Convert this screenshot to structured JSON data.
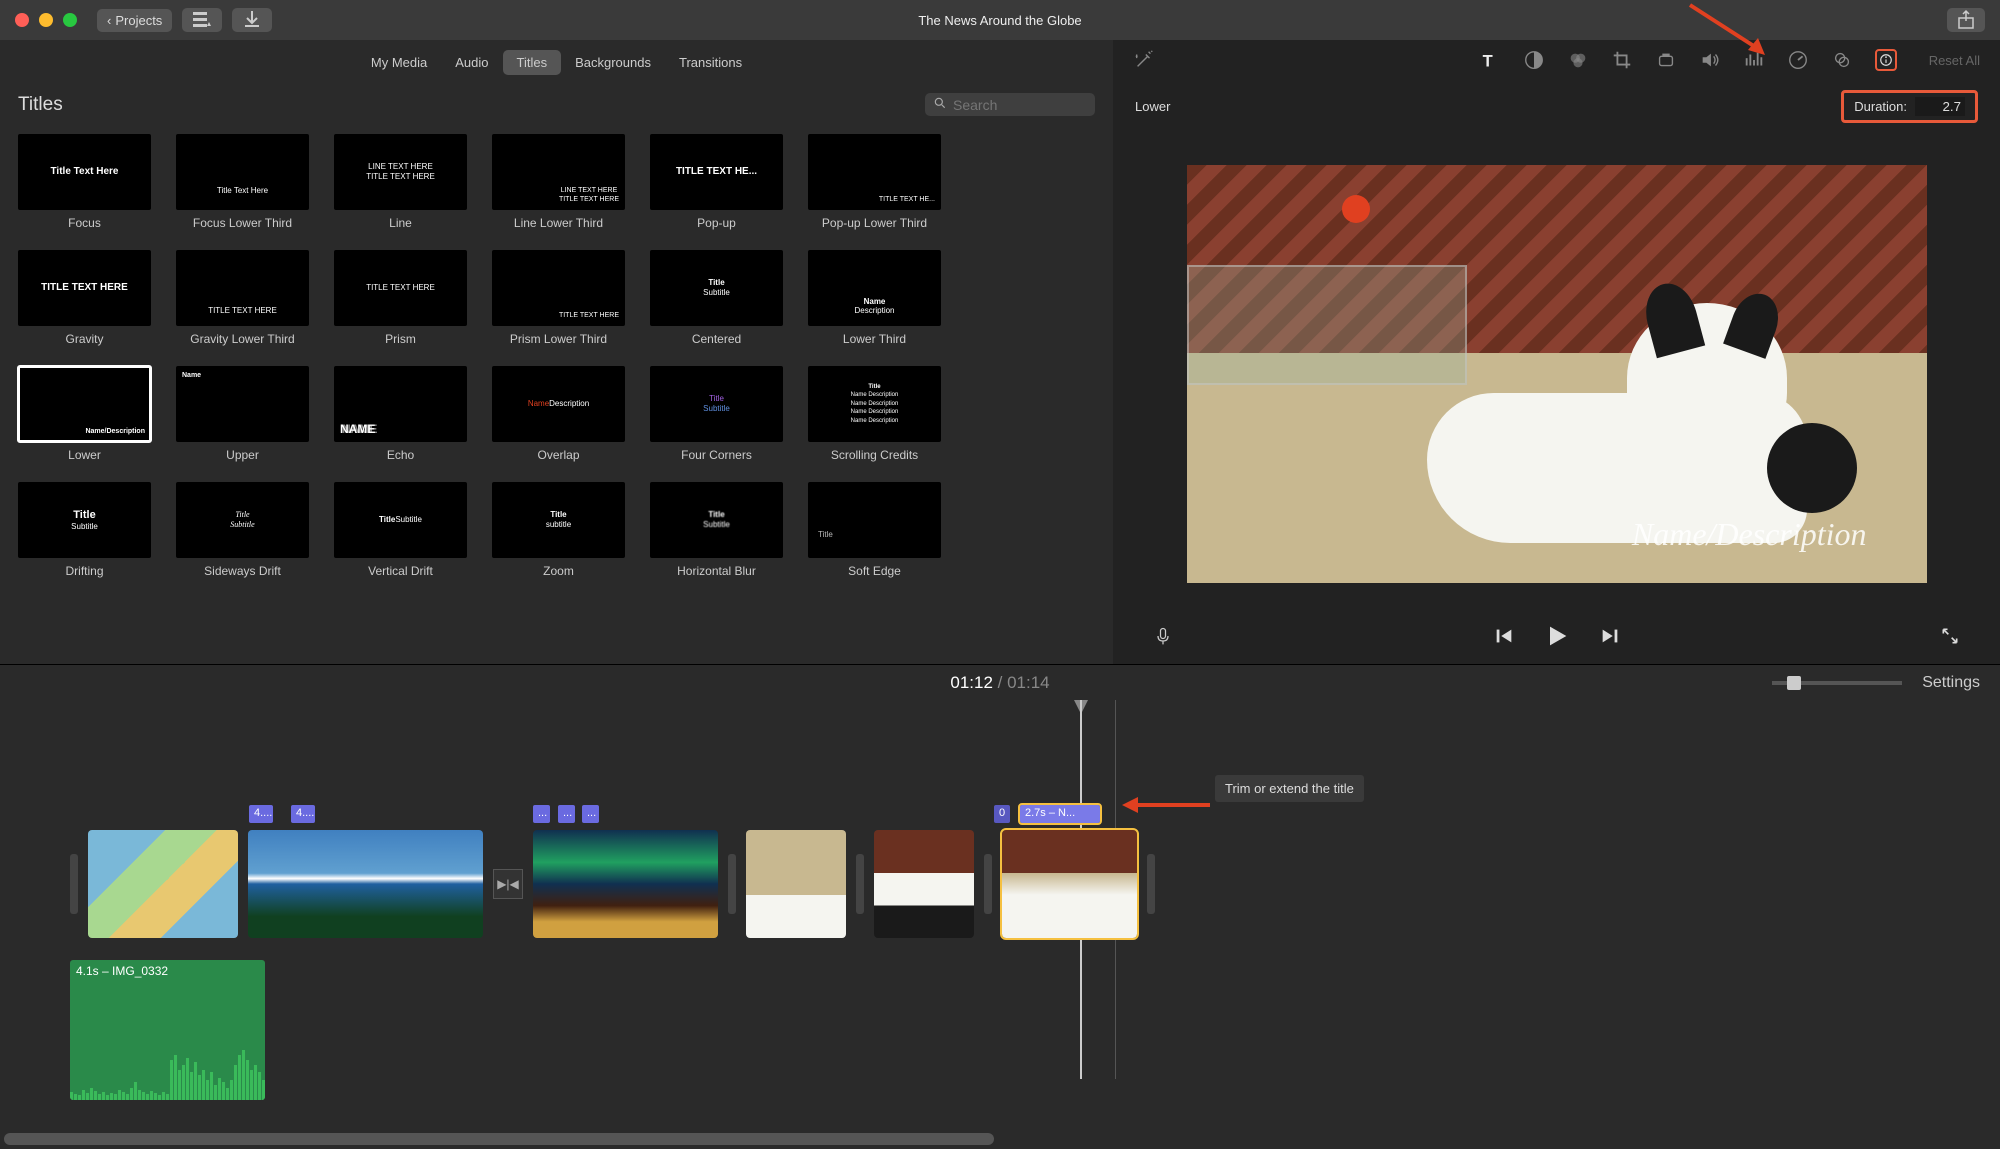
{
  "window": {
    "title": "The News Around the Globe",
    "back_label": "Projects"
  },
  "tabs": {
    "my_media": "My Media",
    "audio": "Audio",
    "titles": "Titles",
    "backgrounds": "Backgrounds",
    "transitions": "Transitions"
  },
  "browser": {
    "section_title": "Titles",
    "search_placeholder": "Search"
  },
  "titles_grid": [
    {
      "label": "Focus"
    },
    {
      "label": "Focus Lower Third"
    },
    {
      "label": "Line"
    },
    {
      "label": "Line Lower Third"
    },
    {
      "label": "Pop-up"
    },
    {
      "label": "Pop-up Lower Third"
    },
    {
      "label": "Gravity"
    },
    {
      "label": "Gravity Lower Third"
    },
    {
      "label": "Prism"
    },
    {
      "label": "Prism Lower Third"
    },
    {
      "label": "Centered"
    },
    {
      "label": "Lower Third"
    },
    {
      "label": "Lower",
      "selected": true
    },
    {
      "label": "Upper"
    },
    {
      "label": "Echo"
    },
    {
      "label": "Overlap"
    },
    {
      "label": "Four Corners"
    },
    {
      "label": "Scrolling Credits"
    },
    {
      "label": "Drifting"
    },
    {
      "label": "Sideways Drift"
    },
    {
      "label": "Vertical Drift"
    },
    {
      "label": "Zoom"
    },
    {
      "label": "Horizontal Blur"
    },
    {
      "label": "Soft Edge"
    }
  ],
  "inspector": {
    "reset_all": "Reset All",
    "clip_name": "Lower",
    "duration_label": "Duration:",
    "duration_value": "2.7"
  },
  "viewer": {
    "title_overlay": "Name/Description"
  },
  "timecode": {
    "current": "01:12",
    "separator": " / ",
    "total": "01:14"
  },
  "timeline": {
    "settings": "Settings",
    "title_clips": {
      "t1": "4....",
      "t2": "4....",
      "t3": "...",
      "t4": "...",
      "t5": "...",
      "t6": "0",
      "t7": "2.7s – N..."
    },
    "audio_label": "4.1s – IMG_0332",
    "tooltip": "Trim or extend the title"
  }
}
